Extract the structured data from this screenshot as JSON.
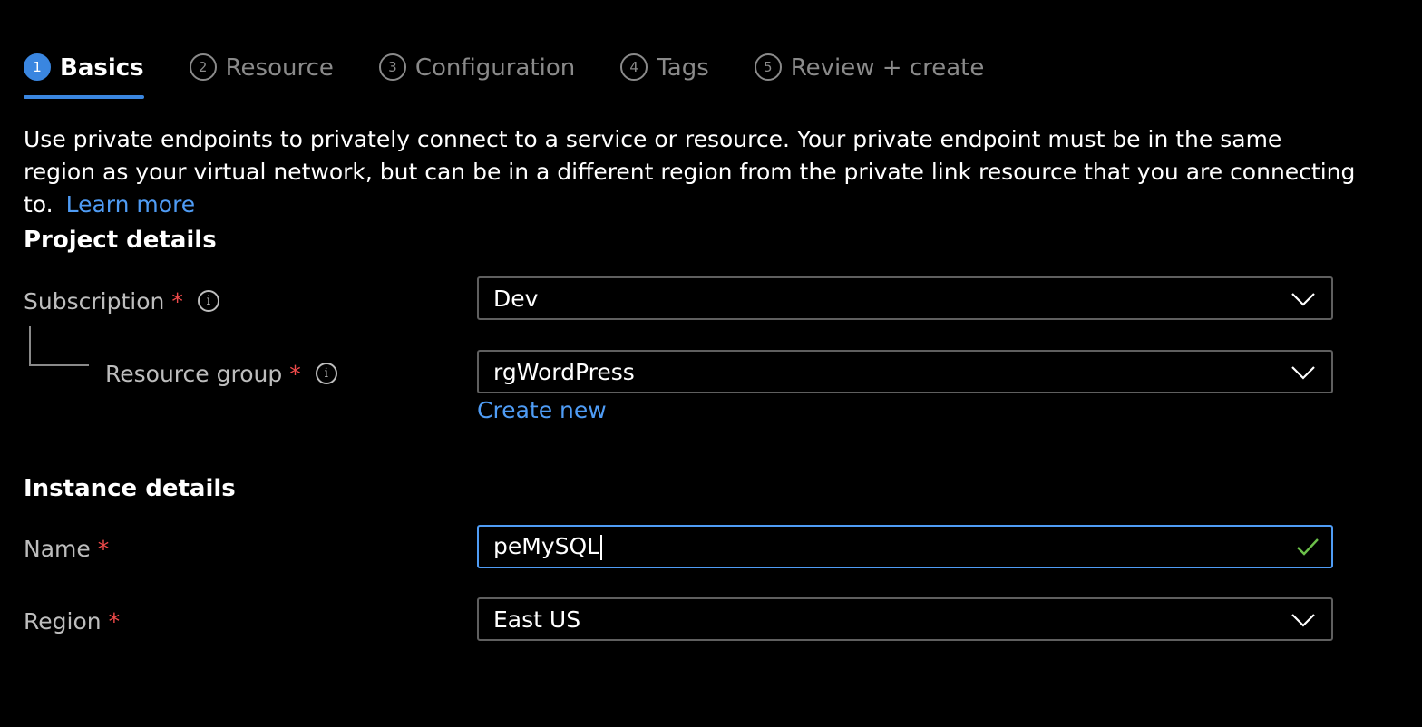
{
  "steps": [
    {
      "number": "1",
      "label": "Basics",
      "active": true
    },
    {
      "number": "2",
      "label": "Resource"
    },
    {
      "number": "3",
      "label": "Configuration"
    },
    {
      "number": "4",
      "label": "Tags"
    },
    {
      "number": "5",
      "label": "Review + create"
    }
  ],
  "description": {
    "text": "Use private endpoints to privately connect to a service or resource. Your private endpoint must be in the same region as your virtual network, but can be in a different region from the private link resource that you are connecting to.",
    "learn_more": "Learn more"
  },
  "project_details": {
    "title": "Project details",
    "subscription": {
      "label": "Subscription",
      "required": "*",
      "value": "Dev"
    },
    "resource_group": {
      "label": "Resource group",
      "required": "*",
      "value": "rgWordPress",
      "create_new": "Create new"
    }
  },
  "instance_details": {
    "title": "Instance details",
    "name": {
      "label": "Name",
      "required": "*",
      "value": "peMySQL"
    },
    "region": {
      "label": "Region",
      "required": "*",
      "value": "East US"
    }
  },
  "colors": {
    "accent": "#3a86e0",
    "link": "#4f9cf5",
    "required": "#f04a4a",
    "valid": "#6cc04a"
  },
  "icons": {
    "info": "info-icon",
    "dropdown": "chevron-down-icon",
    "valid": "checkmark-icon"
  }
}
